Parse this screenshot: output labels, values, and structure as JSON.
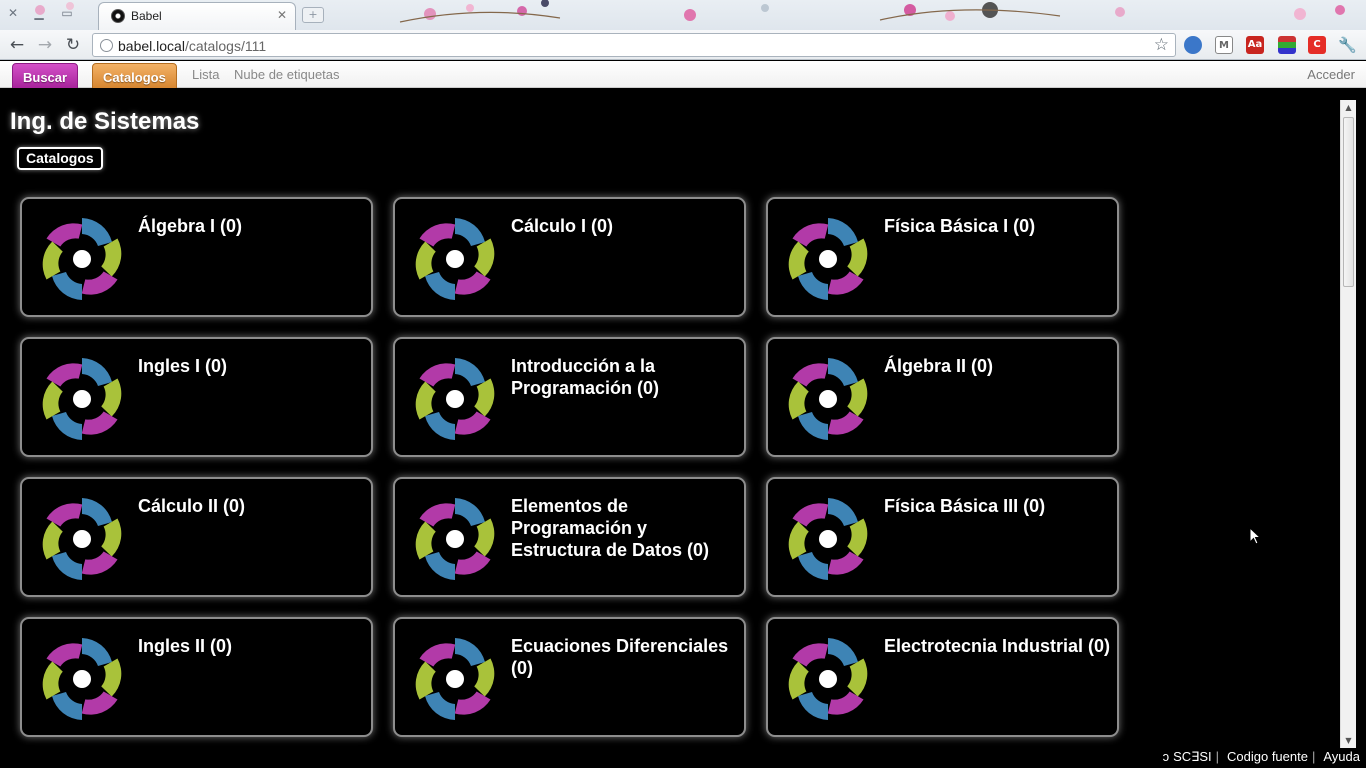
{
  "browser": {
    "tab_title": "Babel",
    "url_host": "babel.local",
    "url_path": "/catalogs/111"
  },
  "appbar": {
    "buscar": "Buscar",
    "catalogos": "Catalogos",
    "lista": "Lista",
    "nube": "Nube de etiquetas",
    "acceder": "Acceder"
  },
  "page": {
    "title": "Ing. de Sistemas",
    "breadcrumb": "Catalogos"
  },
  "catalogs": [
    {
      "title": "Álgebra I (0)"
    },
    {
      "title": "Cálculo I (0)"
    },
    {
      "title": "Física Básica I (0)"
    },
    {
      "title": "Ingles I (0)"
    },
    {
      "title": "Introducción a la Programación (0)"
    },
    {
      "title": "Álgebra II (0)"
    },
    {
      "title": "Cálculo II (0)"
    },
    {
      "title": "Elementos de Programación y Estructura de Datos (0)"
    },
    {
      "title": "Física Básica III (0)"
    },
    {
      "title": "Ingles II (0)"
    },
    {
      "title": "Ecuaciones Diferenciales (0)"
    },
    {
      "title": "Electrotecnia Industrial (0)"
    }
  ],
  "footer": {
    "org": "SC∃SI",
    "source": "Codigo fuente",
    "help": "Ayuda"
  },
  "colors": {
    "buscar": "#c63bba",
    "catalogos": "#e69a45",
    "logo_magenta": "#b23aa8",
    "logo_green": "#a9c23a",
    "logo_blue": "#3e84b5"
  }
}
